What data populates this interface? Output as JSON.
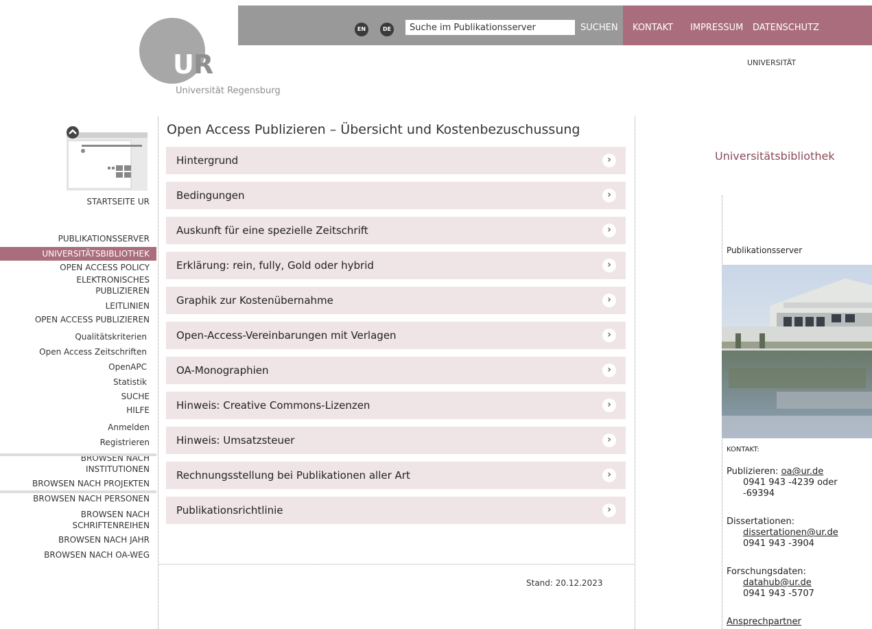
{
  "header": {
    "logo_caption": "Universität Regensburg",
    "logo_letters": "UR",
    "lang_en": "EN",
    "lang_de": "DE",
    "search_placeholder": "Suche im Publikationsserver",
    "search_button": "SUCHEN",
    "top_nav": [
      "KONTAKT",
      "IMPRESSUM",
      "DATENSCHUTZ"
    ],
    "uni_label": "UNIVERSITÄT"
  },
  "sidebar": {
    "startseite": "STARTSEITE UR",
    "items": [
      {
        "label": "PUBLIKATIONSSERVER"
      },
      {
        "label": "UNIVERSITÄTSBIBLIOTHEK"
      },
      {
        "label": "OPEN ACCESS POLICY"
      },
      {
        "label": "ELEKTRONISCHES PUBLIZIEREN"
      },
      {
        "label": "LEITLINIEN"
      },
      {
        "label": "OPEN ACCESS PUBLIZIEREN"
      },
      {
        "label": "Qualitätskriterien"
      },
      {
        "label": "Open Access Zeitschriften"
      },
      {
        "label": "OpenAPC"
      },
      {
        "label": "Statistik"
      },
      {
        "label": "SUCHE"
      },
      {
        "label": "HILFE"
      },
      {
        "label": "Anmelden"
      },
      {
        "label": "Registrieren"
      },
      {
        "label": "BROWSEN NACH INSTITUTIONEN"
      },
      {
        "label": "BROWSEN NACH PROJEKTEN"
      },
      {
        "label": "BROWSEN NACH PERSONEN"
      },
      {
        "label": "BROWSEN NACH SCHRIFTENREIHEN"
      },
      {
        "label": "BROWSEN NACH JAHR"
      },
      {
        "label": "BROWSEN NACH OA-WEG"
      }
    ]
  },
  "main": {
    "title": "Open Access Publizieren – Übersicht und Kostenbezuschussung",
    "sections": [
      {
        "label": "Hintergrund"
      },
      {
        "label": "Bedingungen"
      },
      {
        "label": "Auskunft für eine spezielle Zeitschrift"
      },
      {
        "label": "Erklärung: rein, fully, Gold oder hybrid"
      },
      {
        "label": "Graphik zur Kostenübernahme"
      },
      {
        "label": "Open-Access-Vereinbarungen mit Verlagen"
      },
      {
        "label": "OA-Monographien"
      },
      {
        "label": "Hinweis: Creative Commons-Lizenzen"
      },
      {
        "label": "Hinweis: Umsatzsteuer"
      },
      {
        "label": "Rechnungsstellung bei Publikationen aller Art"
      },
      {
        "label": "Publikationsrichtlinie"
      }
    ],
    "stand": "Stand: 20.12.2023"
  },
  "right": {
    "ub_title": "Universitätsbibliothek",
    "pub_heading": "Publikationsserver",
    "kontakt_heading": "KONTAKT:",
    "publizieren_label": "Publizieren:",
    "publizieren_email": "oa@ur.de",
    "publizieren_phone": "0941 943 -4239 oder -69394",
    "diss_label": "Dissertationen:",
    "diss_email": "dissertationen@ur.de",
    "diss_phone": "0941 943 -3904",
    "fd_label": "Forschungsdaten:",
    "fd_email": "datahub@ur.de",
    "fd_phone": "0941 943 -5707",
    "ansprech": "Ansprechpartner"
  }
}
